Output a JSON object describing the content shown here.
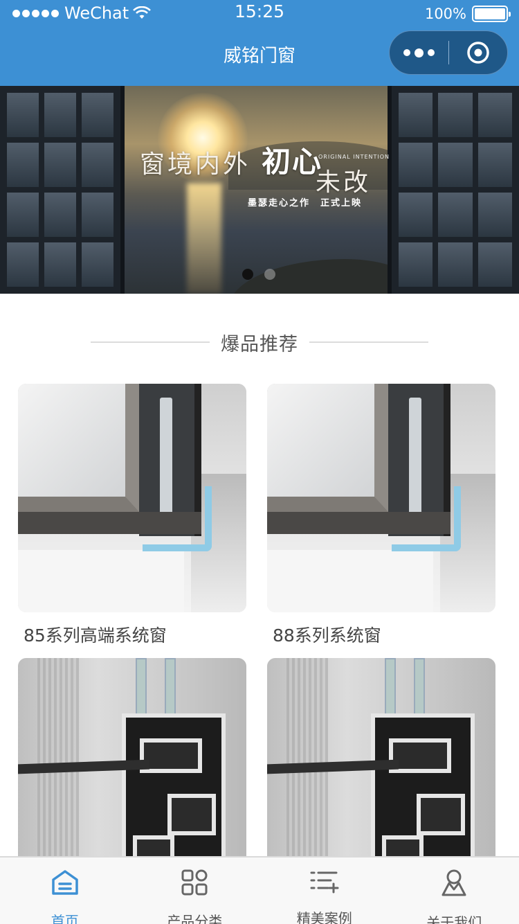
{
  "status_bar": {
    "carrier": "WeChat",
    "time": "15:25",
    "battery": "100%"
  },
  "nav": {
    "title": "威铭门窗"
  },
  "banner": {
    "slogan_main": "窗境内外",
    "slogan_emphasis": "初心",
    "slogan_tail": "未改",
    "slogan_en": "ORIGINAL INTENTION",
    "slogan_sub": "墨瑟走心之作　正式上映",
    "slide_count": 2,
    "active_slide": 1
  },
  "section": {
    "title": "爆品推荐"
  },
  "products": [
    {
      "name": "85系列高端系统窗",
      "image": "window-corner-photo"
    },
    {
      "name": "88系列系统窗",
      "image": "window-corner-photo"
    },
    {
      "name": "",
      "image": "aluminium-profile-section"
    },
    {
      "name": "",
      "image": "aluminium-profile-section"
    }
  ],
  "tabbar": {
    "accent": "#3d90d4",
    "items": [
      {
        "label": "首页",
        "icon": "home-icon",
        "active": true
      },
      {
        "label": "产品分类",
        "icon": "category-grid-icon",
        "active": false
      },
      {
        "label": "精美案例",
        "icon": "case-list-icon",
        "active": false
      },
      {
        "label": "关于我们",
        "icon": "user-icon",
        "active": false
      }
    ]
  }
}
